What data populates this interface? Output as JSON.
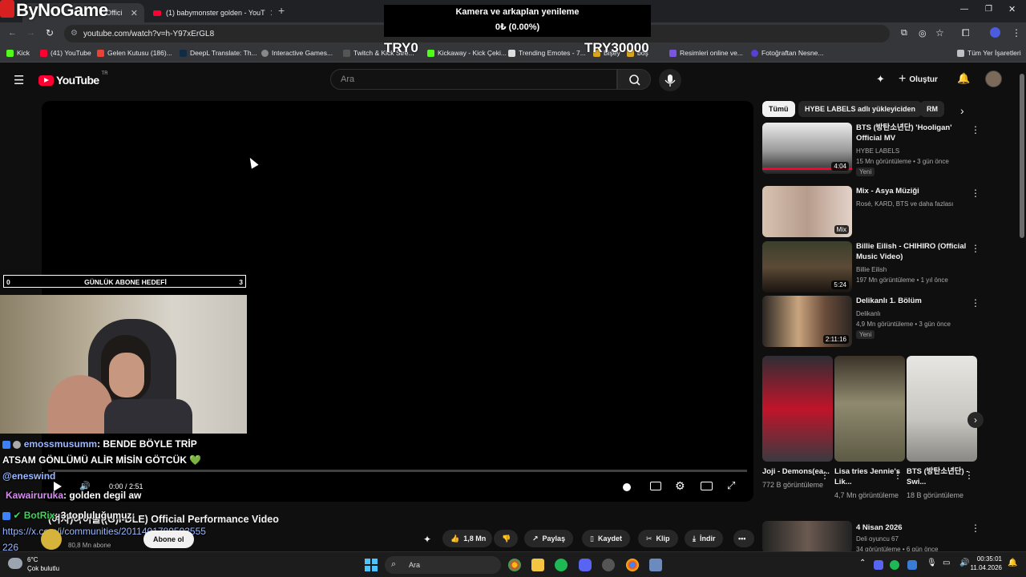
{
  "browser": {
    "tabs": [
      {
        "label": "Offici",
        "active": true
      },
      {
        "label": "(1) babymonster golden - YouT",
        "active": false
      }
    ],
    "new_tab": "+",
    "url": "youtube.com/watch?v=h-Y97xErGL8",
    "bookmarks": [
      "Kick",
      "(41) YouTube",
      "Gelen Kutusu (186)...",
      "DeepL Translate: Th...",
      "Interactive Games...",
      "Twitch & Kick Stre...",
      "Kickaway - Kick Çeki...",
      "Trending Emotes - 7...",
      "Bişey",
      "boş",
      "Resimleri online ve...",
      "Fotoğraftan Nesne..."
    ],
    "all_bookmarks": "Tüm Yer İşaretleri"
  },
  "overlay": {
    "brand": "ByNoGame",
    "donation_title": "Kamera ve arkaplan yenileme",
    "donation_value": "0₺ (0.00%)",
    "try_left": "TRY0",
    "try_right": "TRY30000",
    "goal_left": "0",
    "goal_label": "GÜNLÜK ABONE HEDEFİ",
    "goal_right": "3"
  },
  "youtube": {
    "logo": "YouTube",
    "region": "TR",
    "search_placeholder": "Ara",
    "create_label": "Oluştur",
    "player_time": "0:00 / 2:51",
    "video_title": "(여자)아이들((G)I-DLE) Official Performance Video",
    "channel_subs": "80,8 Mn abone",
    "subscribe": "Abone ol",
    "like_count": "1,8 Mn",
    "share": "Paylaş",
    "save": "Kaydet",
    "clip": "Klip",
    "download": "İndir",
    "chips": [
      "Tümü",
      "HYBE LABELS adlı yükleyiciden",
      "RM"
    ],
    "recs": [
      {
        "title": "BTS (방탄소년단) 'Hooligan' Official MV",
        "channel": "HYBE LABELS",
        "stats": "15 Mn görüntüleme • 3 gün önce",
        "tag": "Yeni",
        "duration": "4:04"
      },
      {
        "title": "Mix - Asya Müziği",
        "channel": "Rosé, KARD, BTS ve daha fazlası",
        "stats": "",
        "tag": "",
        "duration": "Mix"
      },
      {
        "title": "Billie Eilish - CHIHIRO (Official Music Video)",
        "channel": "Billie Eilish",
        "stats": "197 Mn görüntüleme • 1 yıl önce",
        "tag": "",
        "duration": "5:24"
      },
      {
        "title": "Delikanlı 1. Bölüm",
        "channel": "Delikanlı",
        "stats": "4,9 Mn görüntüleme • 3 gün önce",
        "tag": "Yeni",
        "duration": "2:11:16"
      }
    ],
    "shorts": [
      {
        "title": "Joji - Demons(ea...",
        "views": "772 B görüntüleme"
      },
      {
        "title": "Lisa tries Jennie's Lik...",
        "views": "4,7 Mn görüntüleme"
      },
      {
        "title": "BTS (방탄소년단) - Swi...",
        "views": "18 B görüntüleme"
      }
    ],
    "last_rec": {
      "title": "4 Nisan 2026",
      "channel": "Deli oyuncu 67",
      "stats": "34 görüntüleme • 6 gün önce"
    }
  },
  "chat": [
    {
      "user": "emossmusumm",
      "text": ": BENDE BÖYLE TRİP",
      "cont": "ATSAM GÖNLÜMÜ ALİR MİSİN GÖTCÜK 💚",
      "color": "#9ab8ff"
    },
    {
      "user": "@eneswind",
      "color": "#9ab8ff"
    },
    {
      "user": "Kawairuruka",
      "text": ": golden degil aw",
      "color": "#d98cf2"
    },
    {
      "user": "BotRix",
      "text": ": 3 topluluğumuz:",
      "color": "#3fd45a"
    },
    {
      "link": "https://x.com/i/communities/2011401789593555",
      "cont2": "226"
    }
  ],
  "taskbar": {
    "temp": "6°C",
    "weather": "Çok bulutlu",
    "search": "Ara",
    "time": "00:35:01",
    "date": "11.04.2026"
  },
  "colors": {
    "accent": "#ff0033",
    "chip_active": "#f1f1f1",
    "bg": "#0f0f0f"
  }
}
